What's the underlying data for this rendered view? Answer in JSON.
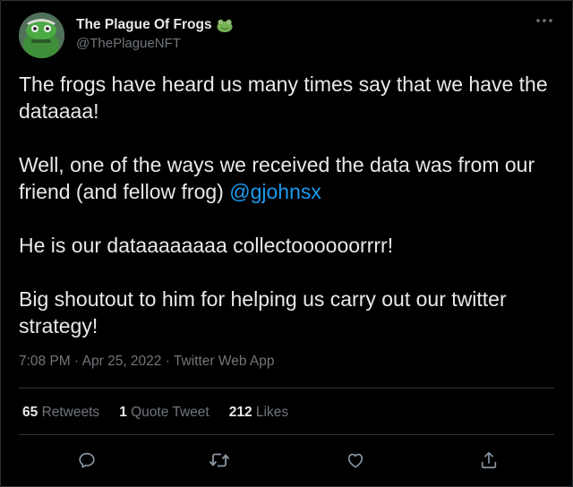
{
  "tweet": {
    "author": {
      "display_name": "The Plague Of Frogs",
      "handle": "@ThePlagueNFT",
      "emoji": "frog-face-icon"
    },
    "paragraphs": [
      "The frogs have heard us many times say that we have the dataaaa!",
      "He is our dataaaaaaaa collectoooooorrrr!",
      "Big shoutout to him for helping us carry out our twitter strategy!"
    ],
    "p2_text": "Well, one of the ways we received the data was from our friend (and fellow frog) ",
    "mention": "@gjohnsx",
    "timestamp": "7:08 PM · Apr 25, 2022 · Twitter Web App",
    "stats": {
      "retweets_count": "65",
      "retweets_label": "Retweets",
      "quotes_count": "1",
      "quotes_label": "Quote Tweet",
      "likes_count": "212",
      "likes_label": "Likes"
    }
  },
  "icons": [
    "more-options-icon",
    "reply-icon",
    "retweet-icon",
    "like-icon",
    "share-icon"
  ],
  "colors": {
    "background": "#000000",
    "text": "#e7e9ea",
    "secondary": "#71767b",
    "link": "#1d9bf0",
    "border": "#2f3336"
  }
}
